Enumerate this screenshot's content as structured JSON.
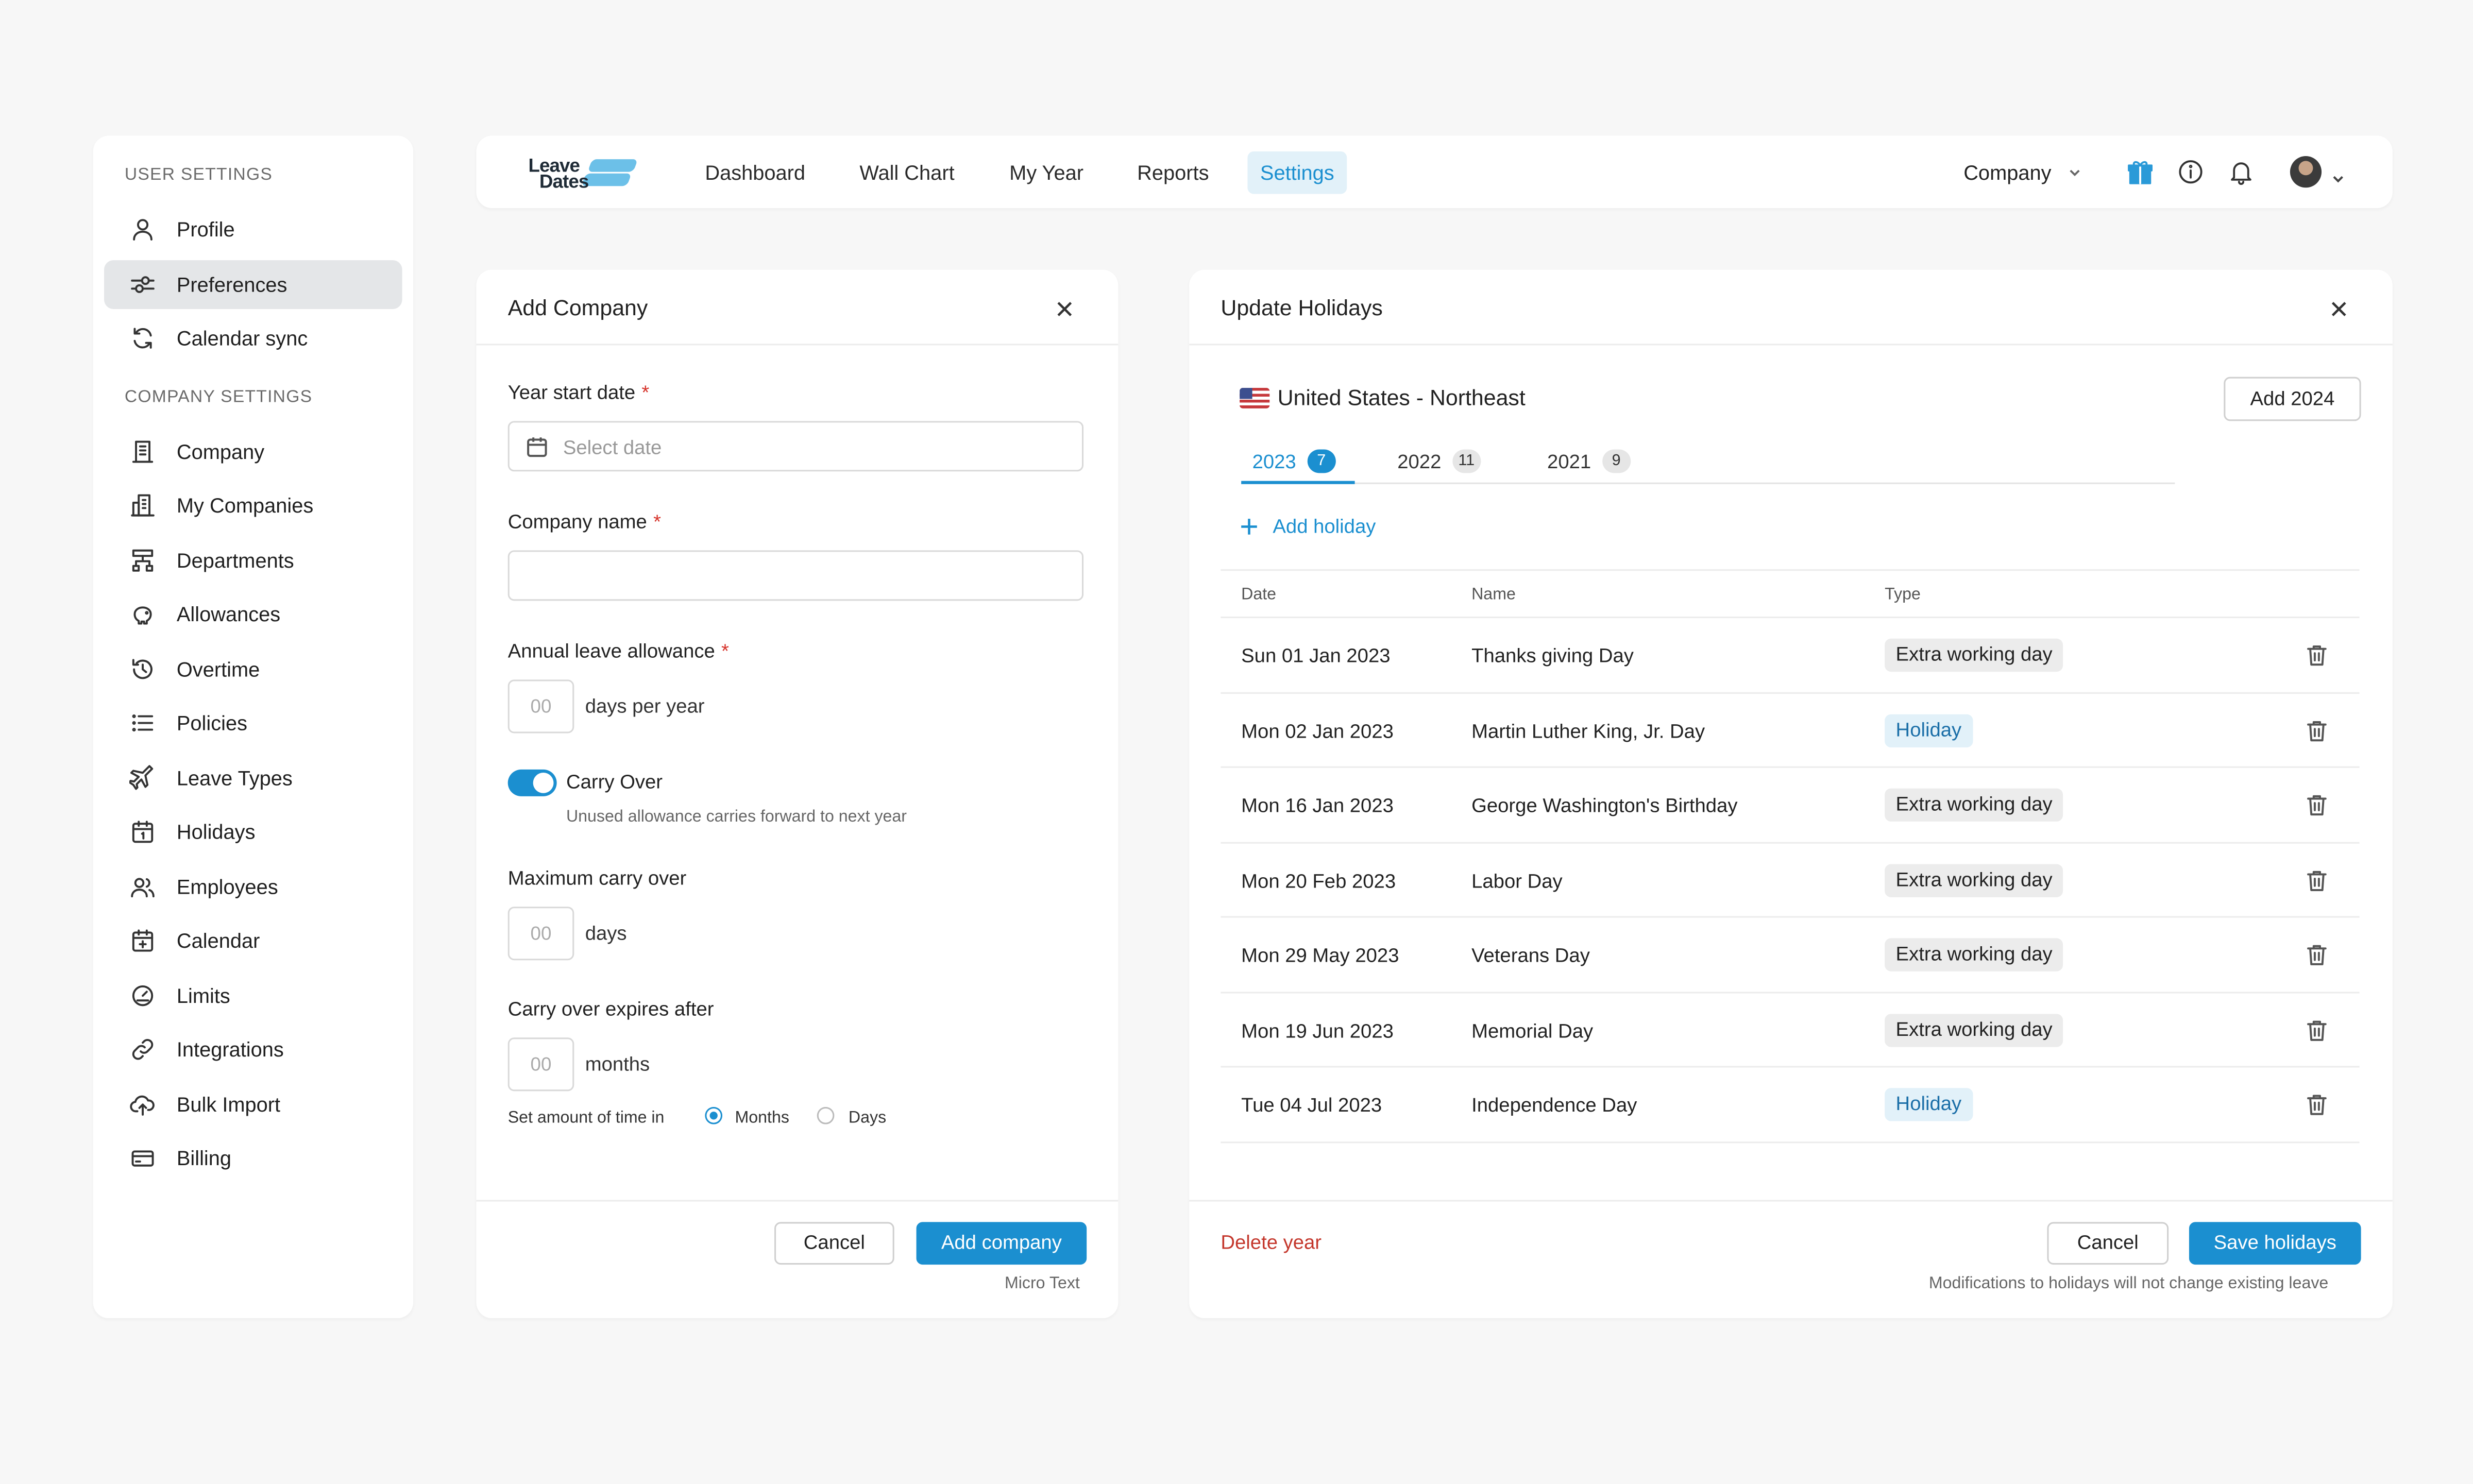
{
  "sidebar": {
    "user_section": "USER SETTINGS",
    "company_section": "COMPANY SETTINGS",
    "user_items": [
      {
        "label": "Profile",
        "icon": "user-icon"
      },
      {
        "label": "Preferences",
        "icon": "sliders-icon",
        "active": true
      },
      {
        "label": "Calendar sync",
        "icon": "sync-icon"
      }
    ],
    "company_items": [
      {
        "label": "Company",
        "icon": "building-icon"
      },
      {
        "label": "My Companies",
        "icon": "buildings-icon"
      },
      {
        "label": "Departments",
        "icon": "sitemap-icon"
      },
      {
        "label": "Allowances",
        "icon": "piggy-bank-icon"
      },
      {
        "label": "Overtime",
        "icon": "clock-history-icon"
      },
      {
        "label": "Policies",
        "icon": "list-icon"
      },
      {
        "label": "Leave Types",
        "icon": "airplane-icon"
      },
      {
        "label": "Holidays",
        "icon": "calendar-day-icon"
      },
      {
        "label": "Employees",
        "icon": "users-icon"
      },
      {
        "label": "Calendar",
        "icon": "calendar-plus-icon"
      },
      {
        "label": "Limits",
        "icon": "gauge-icon"
      },
      {
        "label": "Integrations",
        "icon": "link-icon"
      },
      {
        "label": "Bulk Import",
        "icon": "cloud-upload-icon"
      },
      {
        "label": "Billing",
        "icon": "credit-card-icon"
      }
    ]
  },
  "topnav": {
    "logo_line1": "Leave",
    "logo_line2": "Dates",
    "items": [
      "Dashboard",
      "Wall Chart",
      "My Year",
      "Reports",
      "Settings"
    ],
    "active_item": "Settings",
    "company_select": "Company",
    "icons": [
      "gift-icon",
      "info-icon",
      "bell-icon"
    ]
  },
  "add_company": {
    "title": "Add Company",
    "year_start_label": "Year start date",
    "year_start_placeholder": "Select date",
    "company_name_label": "Company name",
    "annual_label": "Annual leave allowance",
    "annual_placeholder": "00",
    "annual_unit": "days per year",
    "carry_over_label": "Carry Over",
    "carry_over_on": true,
    "carry_over_hint": "Unused allowance carries forward to next year",
    "max_carry_label": "Maximum carry over",
    "max_carry_placeholder": "00",
    "max_carry_unit": "days",
    "expires_label": "Carry over expires after",
    "expires_placeholder": "00",
    "expires_unit": "months",
    "time_in_label": "Set amount of time in",
    "radio_months": "Months",
    "radio_days": "Days",
    "selected_unit": "Months",
    "cancel": "Cancel",
    "submit": "Add company",
    "micro": "Micro Text",
    "required_mark": "*"
  },
  "holidays": {
    "title": "Update Holidays",
    "country": "United States - Northeast",
    "add_year": "Add 2024",
    "tabs": [
      {
        "year": "2023",
        "count": "7",
        "active": true
      },
      {
        "year": "2022",
        "count": "11"
      },
      {
        "year": "2021",
        "count": "9"
      }
    ],
    "add_holiday": "Add holiday",
    "columns": [
      "Date",
      "Name",
      "Type"
    ],
    "rows": [
      {
        "date": "Sun 01 Jan 2023",
        "name": "Thanks giving Day",
        "type": "Extra working day"
      },
      {
        "date": "Mon 02 Jan 2023",
        "name": "Martin Luther King, Jr. Day",
        "type": "Holiday"
      },
      {
        "date": "Mon 16 Jan 2023",
        "name": "George Washington's Birthday",
        "type": "Extra working day"
      },
      {
        "date": "Mon 20 Feb 2023",
        "name": "Labor Day",
        "type": "Extra working day"
      },
      {
        "date": "Mon 29 May 2023",
        "name": "Veterans Day",
        "type": "Extra working day"
      },
      {
        "date": "Mon 19 Jun 2023",
        "name": "Memorial Day",
        "type": "Extra working day"
      },
      {
        "date": "Tue 04 Jul 2023",
        "name": "Independence Day",
        "type": "Holiday"
      }
    ],
    "delete_year": "Delete year",
    "cancel": "Cancel",
    "save": "Save holidays",
    "note": "Modifications to holidays will not change existing leave"
  },
  "colors": {
    "accent": "#1b8fd0",
    "danger": "#c4372c",
    "active_bg": "#e2f1f9"
  }
}
